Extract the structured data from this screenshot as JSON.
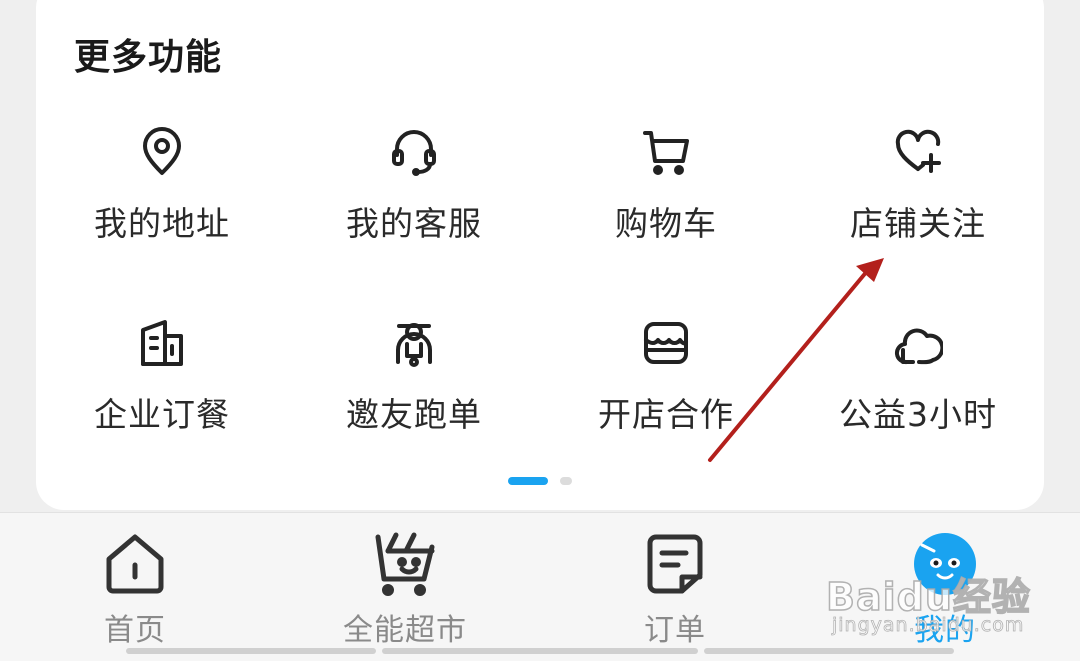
{
  "more_functions": {
    "title": "更多功能",
    "items": [
      {
        "label": "我的地址",
        "icon": "location-pin-icon"
      },
      {
        "label": "我的客服",
        "icon": "headset-icon"
      },
      {
        "label": "购物车",
        "icon": "shopping-cart-icon"
      },
      {
        "label": "店铺关注",
        "icon": "heart-plus-icon"
      },
      {
        "label": "企业订餐",
        "icon": "building-icon"
      },
      {
        "label": "邀友跑单",
        "icon": "scooter-rider-icon"
      },
      {
        "label": "开店合作",
        "icon": "storefront-icon"
      },
      {
        "label": "公益3小时",
        "icon": "cloud-icon"
      }
    ],
    "page_indicator": {
      "pages": 2,
      "current": 1
    }
  },
  "tabbar": {
    "tabs": [
      {
        "label": "首页",
        "icon": "home-icon",
        "active": false
      },
      {
        "label": "全能超市",
        "icon": "supermarket-basket-icon",
        "active": false
      },
      {
        "label": "订单",
        "icon": "order-list-icon",
        "active": false
      },
      {
        "label": "我的",
        "icon": "profile-mascot-icon",
        "active": true
      }
    ]
  },
  "colors": {
    "accent": "#1aa3f0",
    "annotation_arrow": "#b3201c",
    "text": "#1a1a1a",
    "tab_inactive": "#8a8a8a"
  },
  "watermark": {
    "brand": "Baidu经验",
    "url": "jingyan.baidu.com"
  }
}
